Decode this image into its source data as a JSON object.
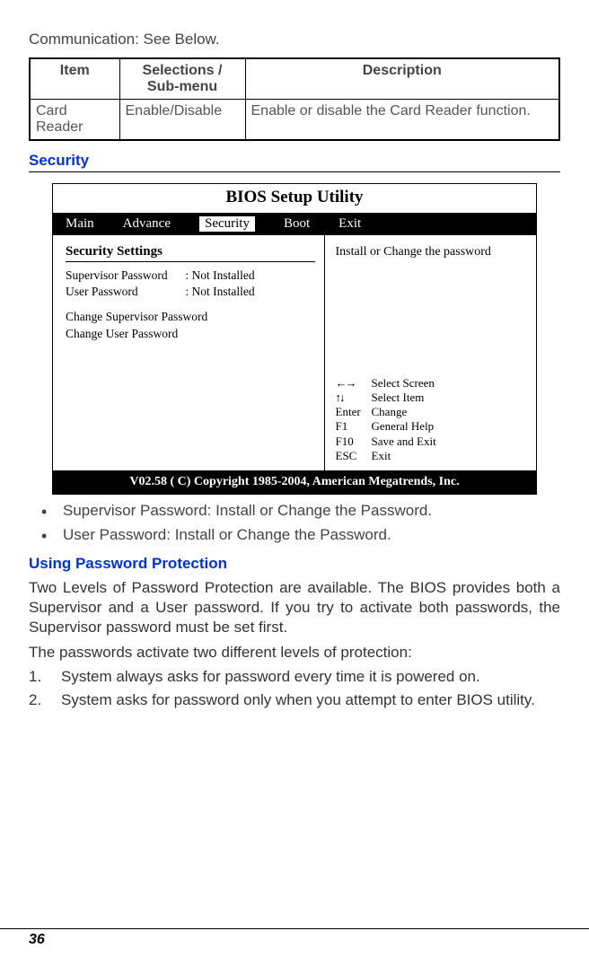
{
  "intro_text": "Communication: See Below.",
  "param_table": {
    "headers": {
      "item": "Item",
      "sel": "Selections / Sub-menu",
      "desc": "Description"
    },
    "rows": [
      {
        "item": "Card Reader",
        "sel": "Enable/Disable",
        "desc": "Enable or disable the Card Reader function."
      }
    ]
  },
  "section_security": "Security",
  "bios": {
    "title": "BIOS Setup Utility",
    "menu": {
      "main": "Main",
      "advance": "Advance",
      "security": "Security",
      "boot": "Boot",
      "exit": "Exit"
    },
    "left": {
      "heading": "Security Settings",
      "sup_label": "Supervisor Password",
      "sup_val": ": Not Installed",
      "usr_label": "User Password",
      "usr_val": ": Not Installed",
      "change_sup": "Change Supervisor Password",
      "change_usr": "Change User Password"
    },
    "right": {
      "help": "Install or Change the password",
      "keys": [
        {
          "k_sym": "lr",
          "v": "Select Screen"
        },
        {
          "k_sym": "ud",
          "v": "Select Item"
        },
        {
          "k": "Enter",
          "v": "Change"
        },
        {
          "k": "F1",
          "v": "General Help"
        },
        {
          "k": "F10",
          "v": "Save and Exit"
        },
        {
          "k": "ESC",
          "v": "Exit"
        }
      ]
    },
    "footer": "V02.58 ( C) Copyright 1985-2004, American Megatrends, Inc."
  },
  "bullets": [
    "Supervisor Password: Install or Change the Password.",
    "User Password: Install or Change the Password."
  ],
  "subsection_pwd": "Using Password Protection",
  "para1": "Two Levels of Password Protection are available. The BIOS provides both a Supervisor and a User password. If you try to activate both passwords, the Supervisor password must be set first.",
  "para2": "The passwords activate two different levels of protection:",
  "num_list": [
    {
      "n": "1.",
      "t": "System always asks for password every time it is powered on."
    },
    {
      "n": "2.",
      "t": "System asks for password only when you attempt to enter BIOS utility."
    }
  ],
  "page_number": "36"
}
